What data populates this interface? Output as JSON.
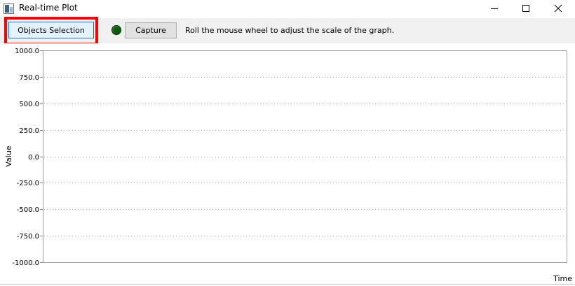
{
  "window": {
    "title": "Real-time Plot",
    "icon": "chart-app-icon",
    "controls": [
      "minimize-icon",
      "maximize-icon",
      "close-icon"
    ]
  },
  "toolbar": {
    "objects_selection_label": "Objects Selection",
    "status_led_color": "#0b5b0b",
    "capture_label": "Capture",
    "hint": "Roll the mouse wheel to adjust the scale of the graph.",
    "highlight_color": "#ff0000"
  },
  "chart_data": {
    "type": "line",
    "title": "",
    "xlabel": "Time",
    "ylabel": "Value",
    "ylim": [
      -1000,
      1000
    ],
    "yticks": [
      1000,
      750,
      500,
      250,
      0,
      -250,
      -500,
      -750,
      -1000
    ],
    "ytick_labels": [
      "1000.0",
      "750.0",
      "500.0",
      "250.0",
      "0.0",
      "-250.0",
      "-500.0",
      "-750.0",
      "-1000.0"
    ],
    "grid": true,
    "series": []
  }
}
